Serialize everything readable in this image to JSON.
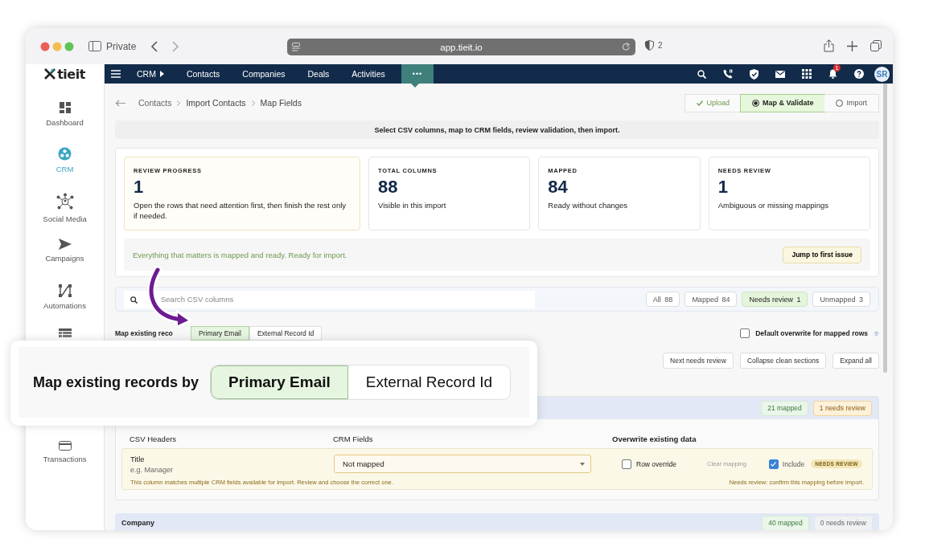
{
  "browser": {
    "private_label": "Private",
    "url": "app.tieit.io",
    "tracker_count": "2"
  },
  "sidebar": {
    "logo": "tieit",
    "items": [
      {
        "label": "Dashboard",
        "selected": false
      },
      {
        "label": "CRM",
        "selected": true
      },
      {
        "label": "Social Media",
        "selected": false
      },
      {
        "label": "Campaigns",
        "selected": false
      },
      {
        "label": "Automations",
        "selected": false
      },
      {
        "label": "Transactions",
        "selected": false
      }
    ]
  },
  "nav": {
    "items": [
      {
        "label": "CRM",
        "kind": "menu",
        "selected": false
      },
      {
        "label": "Contacts",
        "kind": "link",
        "selected": false
      },
      {
        "label": "Companies",
        "kind": "link",
        "selected": false
      },
      {
        "label": "Deals",
        "kind": "link",
        "selected": false
      },
      {
        "label": "Activities",
        "kind": "link",
        "selected": false
      },
      {
        "label": "•••",
        "kind": "more",
        "selected": true
      }
    ],
    "notification_count": "1",
    "avatar_initials": "SR"
  },
  "breadcrumb": [
    "Contacts",
    "Import Contacts",
    "Map Fields"
  ],
  "steps": [
    {
      "label": "Upload",
      "done": true,
      "selected": false
    },
    {
      "label": "Map & Validate",
      "done": false,
      "selected": true
    },
    {
      "label": "Import",
      "done": false,
      "selected": false
    }
  ],
  "instructions": "Select CSV columns, map to CRM fields, review validation, then import.",
  "summary_cards": [
    {
      "title": "REVIEW PROGRESS",
      "value": "1",
      "note": "Open the rows that need attention first, then finish the rest only if needed.",
      "highlighted": true
    },
    {
      "title": "TOTAL COLUMNS",
      "value": "88",
      "note": "Visible in this import",
      "highlighted": false
    },
    {
      "title": "MAPPED",
      "value": "84",
      "note": "Ready without changes",
      "highlighted": false
    },
    {
      "title": "NEEDS REVIEW",
      "value": "1",
      "note": "Ambiguous or missing mappings",
      "highlighted": false
    }
  ],
  "status_message": "Everything that matters is mapped and ready. Ready for import.",
  "jump_button": "Jump to first issue",
  "search": {
    "placeholder": "Search CSV columns"
  },
  "filters": [
    {
      "label": "All",
      "count": "88",
      "selected": false
    },
    {
      "label": "Mapped",
      "count": "84",
      "selected": false
    },
    {
      "label": "Needs review",
      "count": "1",
      "selected": true
    },
    {
      "label": "Unmapped",
      "count": "3",
      "selected": false
    }
  ],
  "match_by": {
    "label": "Map existing reco",
    "options": [
      {
        "label": "Primary Email",
        "selected": true
      },
      {
        "label": "External Record Id",
        "selected": false
      }
    ]
  },
  "default_overwrite": {
    "label": "Default overwrite for mapped rows",
    "checked": false
  },
  "actions": [
    "Next needs review",
    "Collapse clean sections",
    "Expand all"
  ],
  "sections": [
    {
      "badges": [
        {
          "label": "21 mapped",
          "kind": "mapped"
        },
        {
          "label": "1 needs review",
          "kind": "review"
        }
      ],
      "columns": [
        "CSV Headers",
        "CRM Fields",
        "Overwrite existing data"
      ],
      "rows": [
        {
          "header": "Title",
          "example": "e.g. Manager",
          "crm_field": "Not mapped",
          "row_override_label": "Row override",
          "row_override": false,
          "clear_label": "Clear mapping",
          "include_label": "Include",
          "include": true,
          "status": "NEEDS REVIEW",
          "kind": "review",
          "message": "This column matches multiple CRM fields available for import. Review and choose the correct one.",
          "warning": "Needs review: confirm this mapping before import."
        }
      ]
    },
    {
      "title": "Company",
      "badges": [
        {
          "label": "40 mapped",
          "kind": "mapped"
        },
        {
          "label": "0 needs review",
          "kind": "none"
        }
      ]
    }
  ],
  "callout": {
    "label": "Map existing records by",
    "options": [
      {
        "label": "Primary Email",
        "selected": true
      },
      {
        "label": "External Record Id",
        "selected": false
      }
    ]
  }
}
